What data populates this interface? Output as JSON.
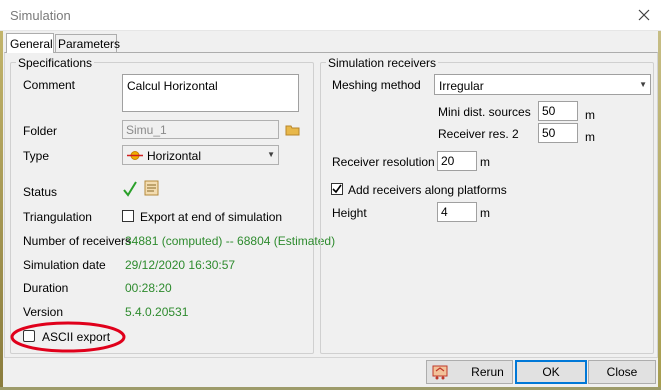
{
  "window": {
    "title": "Simulation"
  },
  "tabs": [
    {
      "label": "General"
    },
    {
      "label": "Parameters"
    }
  ],
  "specifications": {
    "legend": "Specifications",
    "comment_label": "Comment",
    "comment_value": "Calcul Horizontal",
    "folder_label": "Folder",
    "folder_value": "Simu_1",
    "type_label": "Type",
    "type_value": "Horizontal",
    "status_label": "Status",
    "triangulation_label": "Triangulation",
    "triangulation_checkbox_label": "Export at end of simulation",
    "receivers_label": "Number of receivers",
    "receivers_value": "34881 (computed) -- 68804 (Estimated)",
    "date_label": "Simulation date",
    "date_value": "29/12/2020 16:30:57",
    "duration_label": "Duration",
    "duration_value": "00:28:20",
    "version_label": "Version",
    "version_value": "5.4.0.20531",
    "ascii_label": "ASCII export"
  },
  "receivers": {
    "legend": "Simulation receivers",
    "meshing_label": "Meshing method",
    "meshing_value": "Irregular",
    "mini_dist_label": "Mini dist. sources",
    "mini_dist_value": "50",
    "res2_label": "Receiver res. 2",
    "res2_value": "50",
    "resolution_label": "Receiver resolution",
    "resolution_value": "20",
    "platforms_label": "Add receivers along platforms",
    "height_label": "Height",
    "height_value": "4",
    "unit_m": "m"
  },
  "buttons": {
    "rerun": "Rerun",
    "ok": "OK",
    "close": "Close"
  },
  "colors": {
    "annotation": "#e0001b",
    "green_text": "#2e8b2e",
    "accent": "#0078d7"
  }
}
